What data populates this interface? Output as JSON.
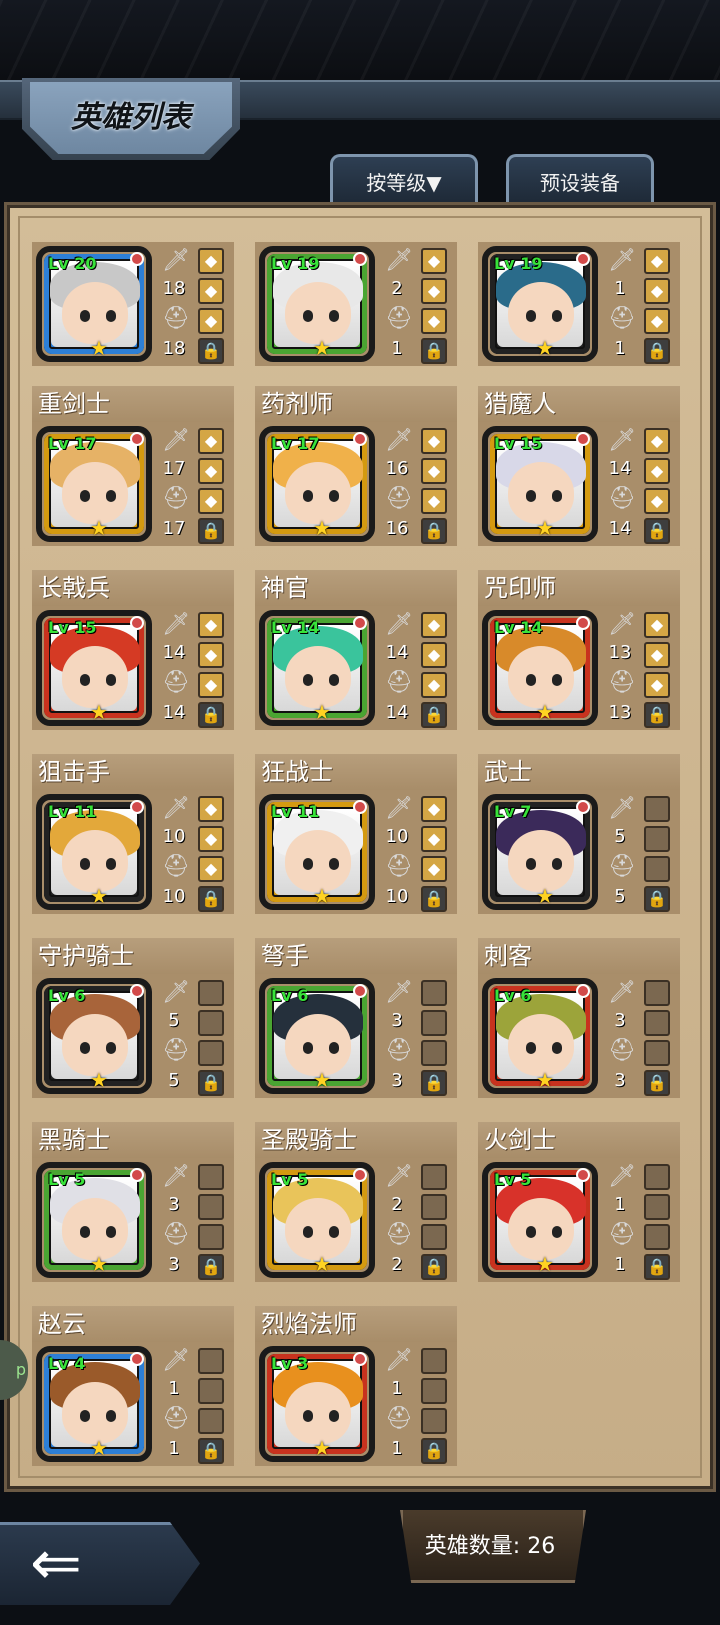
{
  "header": {
    "title": "英雄列表",
    "sort_button": "按等级▼",
    "preset_button": "预设装备"
  },
  "heroes": [
    {
      "name": "",
      "level": "Lv 20",
      "atk": "18",
      "def": "18",
      "frame": "#2d7fd6",
      "hair": "#c8c8c8",
      "slots": [
        "eq",
        "eq",
        "eq",
        "lock"
      ]
    },
    {
      "name": "",
      "level": "Lv 19",
      "atk": "2",
      "def": "1",
      "frame": "#4aa532",
      "hair": "#e8e8e8",
      "slots": [
        "eq",
        "eq",
        "eq",
        "lock"
      ]
    },
    {
      "name": "",
      "level": "Lv 19",
      "atk": "1",
      "def": "1",
      "frame": "#222222",
      "hair": "#2a6b8a",
      "slots": [
        "eq",
        "eq",
        "eq",
        "lock"
      ]
    },
    {
      "name": "重剑士",
      "level": "Lv 17",
      "atk": "17",
      "def": "17",
      "frame": "#d49a10",
      "hair": "#e6b266",
      "slots": [
        "eq",
        "eq",
        "eq",
        "lock"
      ]
    },
    {
      "name": "药剂师",
      "level": "Lv 17",
      "atk": "16",
      "def": "16",
      "frame": "#d49a10",
      "hair": "#f0b14a",
      "slots": [
        "eq",
        "eq",
        "eq",
        "lock"
      ]
    },
    {
      "name": "猎魔人",
      "level": "Lv 15",
      "atk": "14",
      "def": "14",
      "frame": "#d49a10",
      "hair": "#d8d8e8",
      "slots": [
        "eq",
        "eq",
        "eq",
        "lock"
      ]
    },
    {
      "name": "长戟兵",
      "level": "Lv 15",
      "atk": "14",
      "def": "14",
      "frame": "#c8321e",
      "hair": "#d53a24",
      "slots": [
        "eq",
        "eq",
        "eq",
        "lock"
      ]
    },
    {
      "name": "神官",
      "level": "Lv 14",
      "atk": "14",
      "def": "14",
      "frame": "#4aa532",
      "hair": "#3ac49c",
      "slots": [
        "eq",
        "eq",
        "eq",
        "lock"
      ]
    },
    {
      "name": "咒印师",
      "level": "Lv 14",
      "atk": "13",
      "def": "13",
      "frame": "#c8321e",
      "hair": "#d88a2a",
      "slots": [
        "eq",
        "eq",
        "eq",
        "lock"
      ]
    },
    {
      "name": "狙击手",
      "level": "Lv 11",
      "atk": "10",
      "def": "10",
      "frame": "#222222",
      "hair": "#e3a83a",
      "slots": [
        "eq",
        "eq",
        "eq",
        "lock"
      ]
    },
    {
      "name": "狂战士",
      "level": "Lv 11",
      "atk": "10",
      "def": "10",
      "frame": "#d49a10",
      "hair": "#f0f0f0",
      "slots": [
        "eq",
        "eq",
        "eq",
        "lock"
      ]
    },
    {
      "name": "武士",
      "level": "Lv 7",
      "atk": "5",
      "def": "5",
      "frame": "#222222",
      "hair": "#3b2a5a",
      "slots": [
        "empty",
        "empty",
        "empty",
        "lock"
      ]
    },
    {
      "name": "守护骑士",
      "level": "Lv 6",
      "atk": "5",
      "def": "5",
      "frame": "#222222",
      "hair": "#a8643a",
      "slots": [
        "empty",
        "empty",
        "empty",
        "lock"
      ]
    },
    {
      "name": "弩手",
      "level": "Lv 6",
      "atk": "3",
      "def": "3",
      "frame": "#4aa532",
      "hair": "#25303c",
      "slots": [
        "empty",
        "empty",
        "empty",
        "lock"
      ]
    },
    {
      "name": "刺客",
      "level": "Lv 6",
      "atk": "3",
      "def": "3",
      "frame": "#c8321e",
      "hair": "#9ca43a",
      "slots": [
        "empty",
        "empty",
        "empty",
        "lock"
      ]
    },
    {
      "name": "黑骑士",
      "level": "Lv 5",
      "atk": "3",
      "def": "3",
      "frame": "#4aa532",
      "hair": "#e0e0e6",
      "slots": [
        "empty",
        "empty",
        "empty",
        "lock"
      ]
    },
    {
      "name": "圣殿骑士",
      "level": "Lv 5",
      "atk": "2",
      "def": "2",
      "frame": "#d49a10",
      "hair": "#e9c45a",
      "slots": [
        "empty",
        "empty",
        "empty",
        "lock"
      ]
    },
    {
      "name": "火剑士",
      "level": "Lv 5",
      "atk": "1",
      "def": "1",
      "frame": "#c8321e",
      "hair": "#d8322a",
      "slots": [
        "empty",
        "empty",
        "empty",
        "lock"
      ]
    },
    {
      "name": "赵云",
      "level": "Lv 4",
      "atk": "1",
      "def": "1",
      "frame": "#2d7fd6",
      "hair": "#9a5a2a",
      "slots": [
        "empty",
        "empty",
        "empty",
        "lock"
      ]
    },
    {
      "name": "烈焰法师",
      "level": "Lv 3",
      "atk": "1",
      "def": "1",
      "frame": "#c8321e",
      "hair": "#e8901e",
      "slots": [
        "empty",
        "empty",
        "empty",
        "lock"
      ]
    }
  ],
  "footer": {
    "back_icon": "back-arrow-icon",
    "hero_count": "英雄数量: 26"
  },
  "side_marker": "p"
}
